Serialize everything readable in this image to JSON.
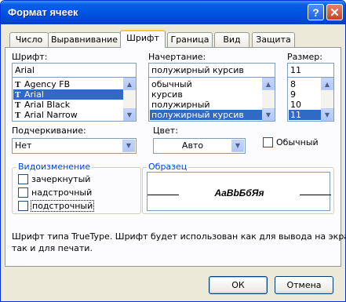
{
  "window": {
    "title": "Формат ячеек"
  },
  "tabs": [
    {
      "label": "Число"
    },
    {
      "label": "Выравнивание"
    },
    {
      "label": "Шрифт"
    },
    {
      "label": "Граница"
    },
    {
      "label": "Вид"
    },
    {
      "label": "Защита"
    }
  ],
  "font": {
    "label": "Шрифт:",
    "value": "Arial",
    "list": [
      "Agency FB",
      "Arial",
      "Arial Black",
      "Arial Narrow"
    ],
    "selected": "Arial",
    "list_icon": "truetype-icon"
  },
  "style": {
    "label": "Начертание:",
    "value": "полужирный курсив",
    "list": [
      "обычный",
      "курсив",
      "полужирный",
      "полужирный курсив"
    ],
    "selected": "полужирный курсив"
  },
  "size": {
    "label": "Размер:",
    "value": "11",
    "list": [
      "8",
      "9",
      "10",
      "11"
    ],
    "selected": "11"
  },
  "underline": {
    "label": "Подчеркивание:",
    "value": "Нет"
  },
  "color": {
    "label": "Цвет:",
    "value": "Авто"
  },
  "normal_font": {
    "label": "Обычный",
    "checked": false
  },
  "effects": {
    "title": "Видоизменение",
    "strikethrough": {
      "label": "зачеркнутый",
      "checked": false
    },
    "superscript": {
      "label": "надстрочный",
      "checked": false
    },
    "subscript": {
      "label": "подстрочный",
      "checked": false
    }
  },
  "preview": {
    "title": "Образец",
    "sample": "AaBbБбЯя"
  },
  "info": {
    "line1": "Шрифт типа TrueType. Шрифт будет использован как для вывода на экран,",
    "line2": "так и для печати."
  },
  "buttons": {
    "ok": "ОК",
    "cancel": "Отмена"
  },
  "colors": {
    "selection": "#316ac5",
    "group_title": "#0046d5",
    "titlebar": "#0054e3"
  }
}
